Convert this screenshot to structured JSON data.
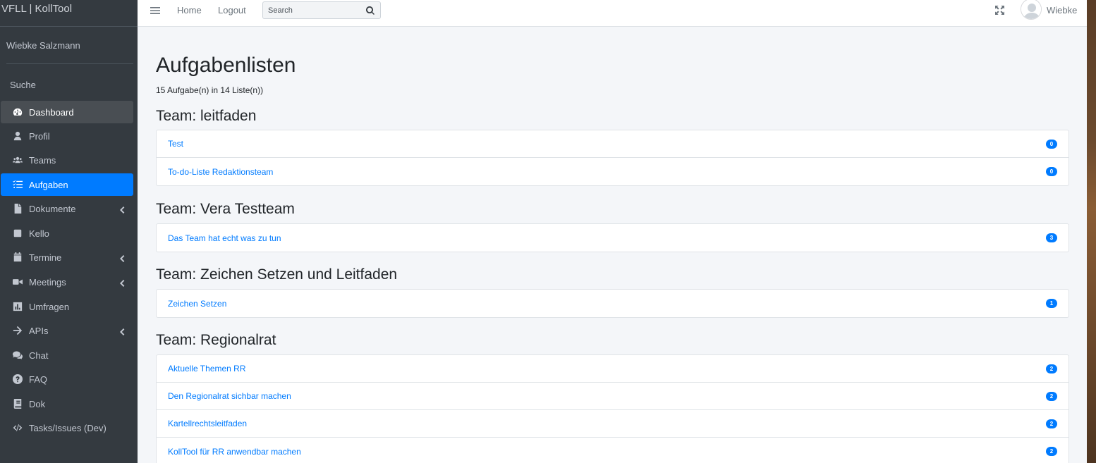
{
  "brand": "VFLL | KollTool",
  "user_panel": {
    "name": "Wiebke Salzmann"
  },
  "sidebar": {
    "search_label": "Suche",
    "items": [
      {
        "label": "Dashboard",
        "icon": "tachometer-icon"
      },
      {
        "label": "Profil",
        "icon": "user-icon"
      },
      {
        "label": "Teams",
        "icon": "users-icon"
      },
      {
        "label": "Aufgaben",
        "icon": "tasks-icon"
      },
      {
        "label": "Dokumente",
        "icon": "file-icon",
        "expandable": true
      },
      {
        "label": "Kello",
        "icon": "square-icon"
      },
      {
        "label": "Termine",
        "icon": "calendar-icon",
        "expandable": true
      },
      {
        "label": "Meetings",
        "icon": "video-icon",
        "expandable": true
      },
      {
        "label": "Umfragen",
        "icon": "poll-icon"
      },
      {
        "label": "APIs",
        "icon": "arrow-right-icon",
        "expandable": true
      },
      {
        "label": "Chat",
        "icon": "comments-icon"
      },
      {
        "label": "FAQ",
        "icon": "question-circle-icon"
      },
      {
        "label": "Dok",
        "icon": "book-icon"
      },
      {
        "label": "Tasks/Issues (Dev)",
        "icon": "code-icon"
      }
    ]
  },
  "topbar": {
    "home": "Home",
    "logout": "Logout",
    "search_placeholder": "Search",
    "user": "Wiebke"
  },
  "main": {
    "title": "Aufgabenlisten",
    "summary": "15 Aufgabe(n) in 14 Liste(n))",
    "teams": [
      {
        "title": "Team: leitfaden",
        "lists": [
          {
            "name": "Test",
            "count": "0"
          },
          {
            "name": "To-do-Liste Redaktionsteam",
            "count": "0"
          }
        ]
      },
      {
        "title": "Team: Vera Testteam",
        "lists": [
          {
            "name": "Das Team hat echt was zu tun",
            "count": "3"
          }
        ]
      },
      {
        "title": "Team: Zeichen Setzen und Leitfaden",
        "lists": [
          {
            "name": "Zeichen Setzen",
            "count": "1"
          }
        ]
      },
      {
        "title": "Team: Regionalrat",
        "lists": [
          {
            "name": "Aktuelle Themen RR",
            "count": "2"
          },
          {
            "name": "Den Regionalrat sichbar machen",
            "count": "2"
          },
          {
            "name": "Kartellrechtsleitfaden",
            "count": "2"
          },
          {
            "name": "KollTool für RR anwendbar machen",
            "count": "2"
          }
        ]
      }
    ]
  },
  "colors": {
    "sidebar_bg": "#343a40",
    "accent": "#007bff",
    "content_bg": "#f4f6f9"
  }
}
